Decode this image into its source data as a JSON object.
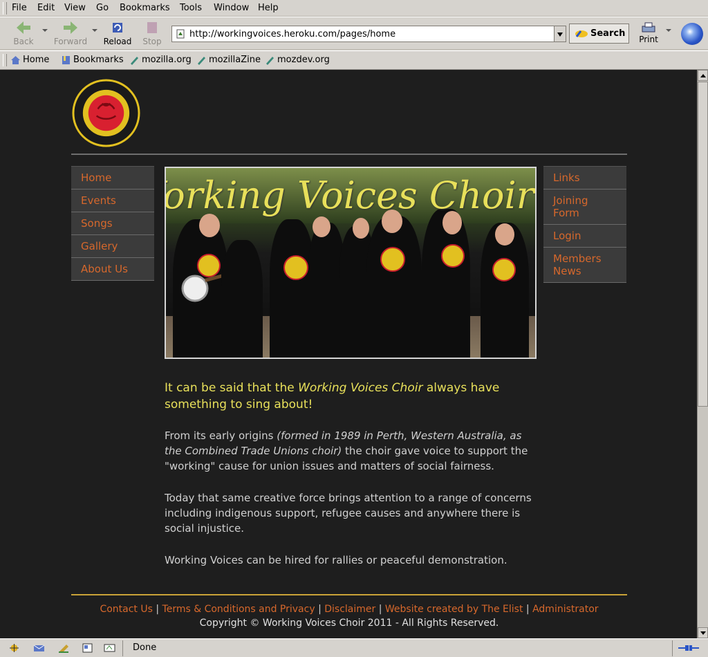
{
  "menu": [
    "File",
    "Edit",
    "View",
    "Go",
    "Bookmarks",
    "Tools",
    "Window",
    "Help"
  ],
  "toolbar": {
    "back": "Back",
    "forward": "Forward",
    "reload": "Reload",
    "stop": "Stop",
    "url": "http://workingvoices.heroku.com/pages/home",
    "search": "Search",
    "print": "Print"
  },
  "personal": [
    "Home",
    "Bookmarks",
    "mozilla.org",
    "mozillaZine",
    "mozdev.org"
  ],
  "page": {
    "hero_title": "Working Voices Choir",
    "left_nav": [
      "Home",
      "Events",
      "Songs",
      "Gallery",
      "About Us"
    ],
    "right_nav": [
      "Links",
      "Joining Form",
      "Login",
      "Members News"
    ],
    "lead_1": "It can be said that the ",
    "lead_em": "Working Voices Choir",
    "lead_2": " always have something to sing about!",
    "p1_a": "From its early origins ",
    "p1_em": "(formed in 1989 in Perth, Western Australia, as the Combined Trade Unions choir)",
    "p1_b": " the choir gave voice to support the \"working\" cause for union issues and matters of social fairness.",
    "p2": "Today that same creative force brings attention to a range of concerns including indigenous support, refugee causes and anywhere there is social injustice.",
    "p3": "Working Voices can be hired for rallies or peaceful demonstration.",
    "footer_links": [
      "Contact Us",
      "Terms & Conditions and Privacy",
      "Disclaimer",
      "Website created by The Elist ",
      "Administrator"
    ],
    "footer_sep": " | ",
    "copyright": "Copyright © Working Voices Choir 2011 - All Rights Reserved."
  },
  "status": "Done",
  "colors": {
    "accent": "#d7682c",
    "title": "#e8e05a",
    "bg": "#1e1e1e",
    "footer_rule": "#c9a338"
  }
}
